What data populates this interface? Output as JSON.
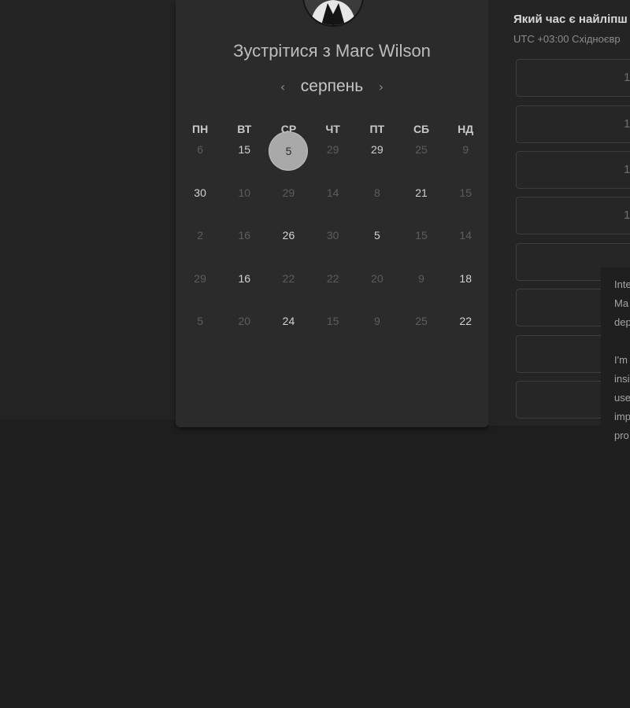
{
  "booking": {
    "title": "Зустрітися з Marc Wilson",
    "month": "серпень",
    "prev_icon": "‹",
    "next_icon": "›",
    "weekdays": [
      "ПН",
      "ВТ",
      "СР",
      "ЧТ",
      "ПТ",
      "СБ",
      "НД"
    ],
    "weeks": [
      [
        {
          "d": "6",
          "a": false
        },
        {
          "d": "15",
          "a": true
        },
        {
          "d": "5",
          "a": true,
          "sel": true
        },
        {
          "d": "29",
          "a": false
        },
        {
          "d": "29",
          "a": true
        },
        {
          "d": "25",
          "a": false
        },
        {
          "d": "9",
          "a": false
        }
      ],
      [
        {
          "d": "30",
          "a": true
        },
        {
          "d": "10",
          "a": false
        },
        {
          "d": "29",
          "a": false
        },
        {
          "d": "14",
          "a": false
        },
        {
          "d": "8",
          "a": false
        },
        {
          "d": "21",
          "a": true
        },
        {
          "d": "15",
          "a": false
        }
      ],
      [
        {
          "d": "2",
          "a": false
        },
        {
          "d": "16",
          "a": false
        },
        {
          "d": "26",
          "a": true
        },
        {
          "d": "30",
          "a": false
        },
        {
          "d": "5",
          "a": true
        },
        {
          "d": "15",
          "a": false
        },
        {
          "d": "14",
          "a": false
        }
      ],
      [
        {
          "d": "29",
          "a": false
        },
        {
          "d": "16",
          "a": true
        },
        {
          "d": "22",
          "a": false
        },
        {
          "d": "22",
          "a": false
        },
        {
          "d": "20",
          "a": false
        },
        {
          "d": "9",
          "a": false
        },
        {
          "d": "18",
          "a": true
        }
      ],
      [
        {
          "d": "5",
          "a": false
        },
        {
          "d": "20",
          "a": false
        },
        {
          "d": "24",
          "a": true
        },
        {
          "d": "15",
          "a": false
        },
        {
          "d": "9",
          "a": false
        },
        {
          "d": "25",
          "a": false
        },
        {
          "d": "22",
          "a": true
        }
      ]
    ]
  },
  "times": {
    "title": "Який час є найліпш",
    "timezone": "UTC +03:00 Східноєвр",
    "slots": [
      "1",
      "1",
      "1",
      "1",
      "",
      "",
      "",
      ""
    ]
  },
  "popup": {
    "lines": [
      "Inte",
      "Ma",
      "dep",
      "",
      "I'm",
      "insi",
      "use",
      "imp",
      "pro"
    ]
  },
  "colors": {
    "background": "#1e1e1e",
    "card": "#2b2b2b",
    "selected": "#a9a9a9"
  }
}
